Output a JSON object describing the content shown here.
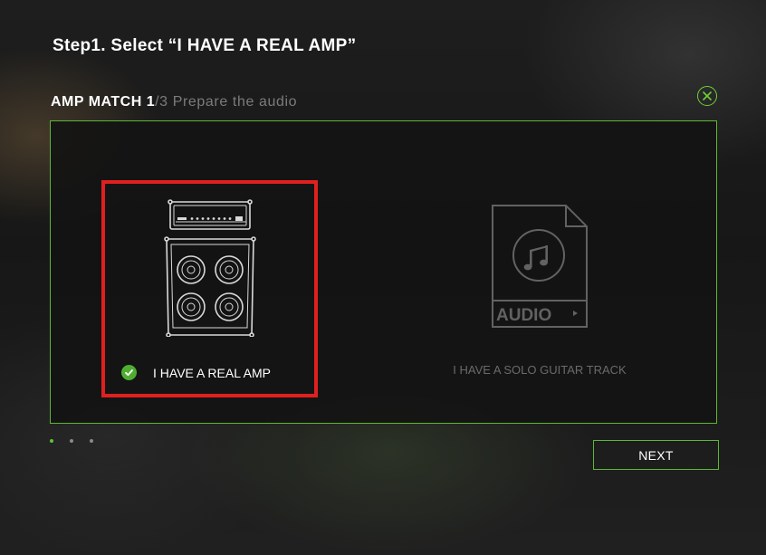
{
  "step_title": "Step1. Select “I HAVE A REAL AMP”",
  "header": {
    "section": "AMP MATCH 1",
    "progress": "/3",
    "subtitle": " Prepare the audio"
  },
  "options": [
    {
      "label": "I HAVE A REAL AMP",
      "selected": true,
      "icon": "amp-stack-icon"
    },
    {
      "label": "I HAVE A SOLO GUITAR TRACK",
      "selected": false,
      "icon": "audio-file-icon",
      "icon_text": "AUDIO"
    }
  ],
  "pagination": {
    "total": 3,
    "current": 1
  },
  "next_label": "NEXT",
  "colors": {
    "accent": "#5cb832",
    "selection": "#e0201f",
    "check": "#4fae32",
    "dim_text": "#6a6a6a"
  }
}
